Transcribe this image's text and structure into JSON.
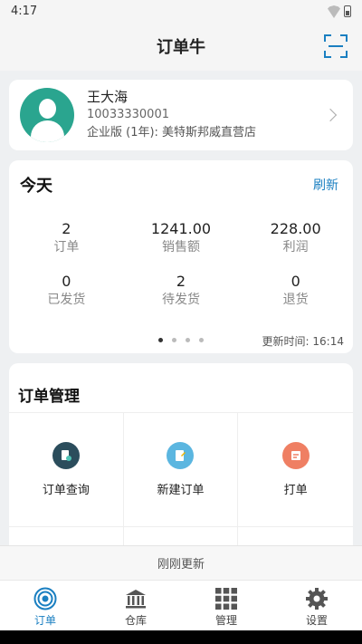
{
  "status_bar": {
    "time": "4:17"
  },
  "header": {
    "title": "订单牛"
  },
  "profile": {
    "name": "王大海",
    "phone": "10033330001",
    "plan": "企业版 (1年): 美特斯邦威直营店"
  },
  "today": {
    "title": "今天",
    "refresh_label": "刷新",
    "stats": [
      {
        "value": "2",
        "label": "订单"
      },
      {
        "value": "1241.00",
        "label": "销售额"
      },
      {
        "value": "228.00",
        "label": "利润"
      },
      {
        "value": "0",
        "label": "已发货"
      },
      {
        "value": "2",
        "label": "待发货"
      },
      {
        "value": "0",
        "label": "退货"
      }
    ],
    "page_index": 1,
    "page_count": 4,
    "update_time": "更新时间: 16:14"
  },
  "orders": {
    "title": "订单管理",
    "items": [
      {
        "label": "订单查询",
        "icon": "order-search-icon",
        "color": "#2b4d5c"
      },
      {
        "label": "新建订单",
        "icon": "new-order-icon",
        "color": "#5bb6e0"
      },
      {
        "label": "打单",
        "icon": "print-order-icon",
        "color": "#ef7f63"
      }
    ]
  },
  "refresh_bar": {
    "text": "刚刚更新"
  },
  "tabbar": {
    "tabs": [
      {
        "label": "订单",
        "icon": "target-icon",
        "active": true
      },
      {
        "label": "仓库",
        "icon": "warehouse-icon",
        "active": false
      },
      {
        "label": "管理",
        "icon": "grid-icon",
        "active": false
      },
      {
        "label": "设置",
        "icon": "gear-icon",
        "active": false
      }
    ]
  },
  "colors": {
    "accent": "#1a7fc1",
    "avatar": "#2aa58f"
  }
}
